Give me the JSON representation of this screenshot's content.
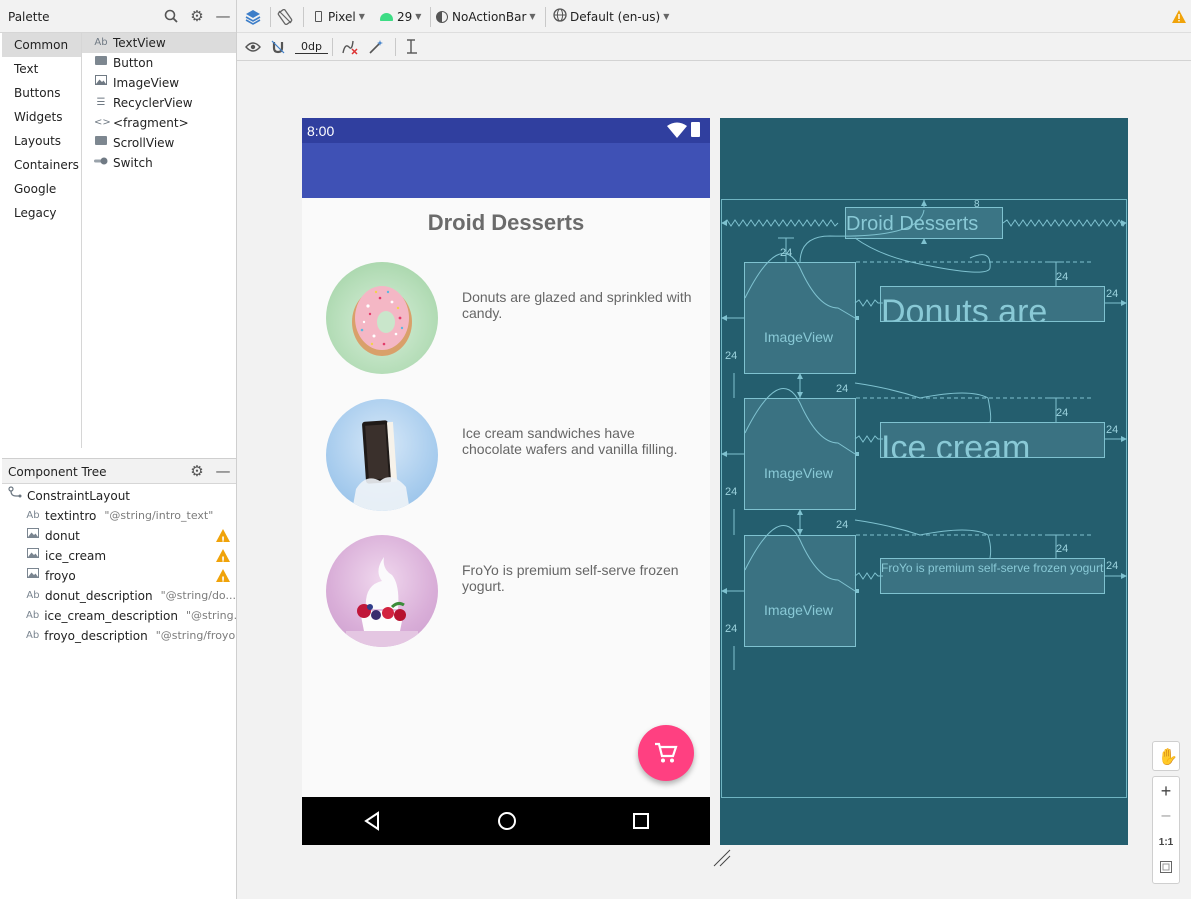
{
  "palette": {
    "title": "Palette",
    "categories": [
      "Common",
      "Text",
      "Buttons",
      "Widgets",
      "Layouts",
      "Containers",
      "Google",
      "Legacy"
    ],
    "items": [
      {
        "label": "TextView",
        "icon": "textview-icon"
      },
      {
        "label": "Button",
        "icon": "button-icon"
      },
      {
        "label": "ImageView",
        "icon": "imageview-icon"
      },
      {
        "label": "RecyclerView",
        "icon": "recyclerview-icon"
      },
      {
        "label": "<fragment>",
        "icon": "fragment-icon"
      },
      {
        "label": "ScrollView",
        "icon": "scrollview-icon"
      },
      {
        "label": "Switch",
        "icon": "switch-icon"
      }
    ]
  },
  "component_tree": {
    "title": "Component Tree",
    "root": "ConstraintLayout",
    "nodes": [
      {
        "name": "textintro",
        "attr": "\"@string/intro_text\"",
        "icon": "textview-icon",
        "warning": false
      },
      {
        "name": "donut",
        "attr": "",
        "icon": "imageview-icon",
        "warning": true
      },
      {
        "name": "ice_cream",
        "attr": "",
        "icon": "imageview-icon",
        "warning": true
      },
      {
        "name": "froyo",
        "attr": "",
        "icon": "imageview-icon",
        "warning": true
      },
      {
        "name": "donut_description",
        "attr": "\"@string/do...",
        "icon": "textview-icon",
        "warning": false
      },
      {
        "name": "ice_cream_description",
        "attr": "\"@string...",
        "icon": "textview-icon",
        "warning": false
      },
      {
        "name": "froyo_description",
        "attr": "\"@string/froyo\"",
        "icon": "textview-icon",
        "warning": false
      }
    ]
  },
  "toolbar": {
    "device": "Pixel",
    "api_level": "29",
    "theme": "NoActionBar",
    "locale": "Default (en-us)",
    "margin_value": "0dp"
  },
  "phone": {
    "time": "8:00",
    "title": "Droid Desserts",
    "descriptions": [
      "Donuts are glazed and sprinkled with candy.",
      "Ice cream sandwiches have chocolate wafers and vanilla filling.",
      "FroYo is premium self-serve frozen yogurt."
    ]
  },
  "blueprint": {
    "title": "Droid Desserts",
    "image_label": "ImageView",
    "texts": [
      "Donuts are",
      "Ice cream",
      "FroYo is premium self-serve frozen yogurt."
    ],
    "margin_top": "8",
    "margin": "24"
  },
  "zoom": {
    "one_to_one": "1:1"
  },
  "colors": {
    "primary": "#3f51b5",
    "primary_dark": "#303f9f",
    "accent": "#ff4081",
    "blueprint_bg": "#245e6e",
    "warning": "#f0a30a"
  }
}
